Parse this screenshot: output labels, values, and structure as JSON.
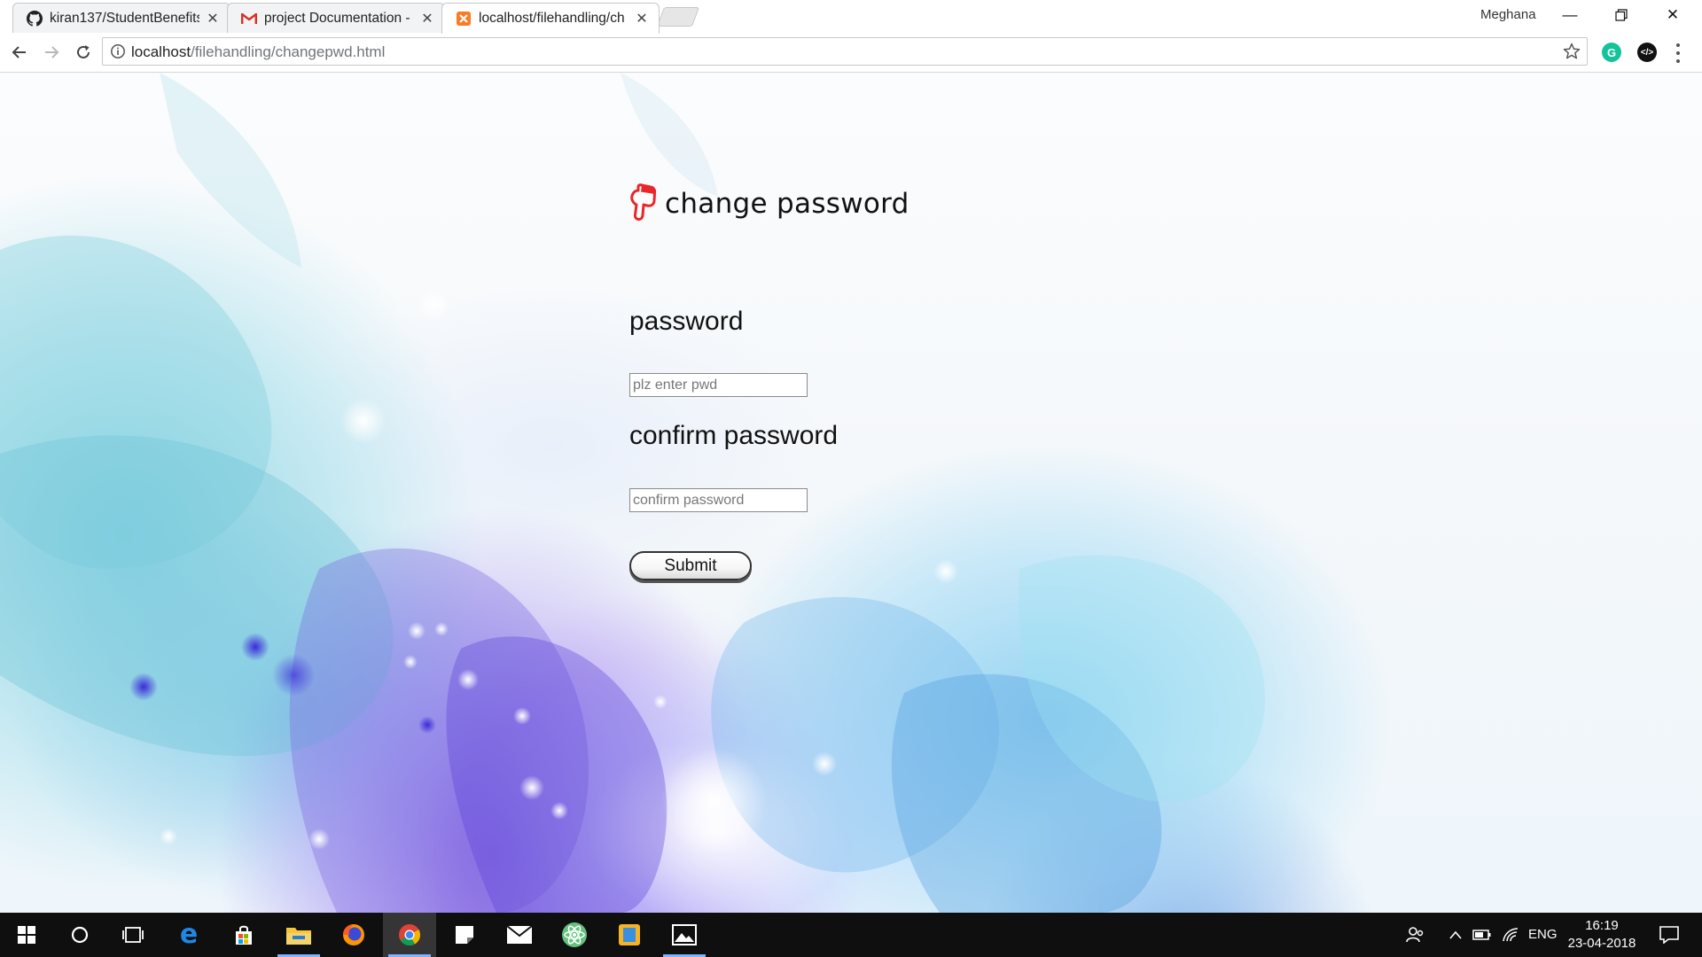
{
  "browser": {
    "tabs": [
      {
        "title": "kiran137/StudentBenefits",
        "favicon": "github-icon",
        "active": false
      },
      {
        "title": "project Documentation -",
        "favicon": "gmail-icon",
        "active": false
      },
      {
        "title": "localhost/filehandling/ch",
        "favicon": "xampp-icon",
        "active": true
      }
    ],
    "profile_name": "Meghana",
    "url_host": "localhost",
    "url_path": "/filehandling/changepwd.html"
  },
  "page": {
    "heading": "change password",
    "password_label": "password",
    "password_placeholder": "plz enter pwd",
    "confirm_label": "confirm password",
    "confirm_placeholder": "confirm password",
    "submit_label": "Submit"
  },
  "taskbar": {
    "apps": [
      "windows-start-icon",
      "cortana-icon",
      "task-view-icon",
      "edge-icon",
      "store-icon",
      "file-explorer-icon",
      "firefox-icon",
      "chrome-icon",
      "sticky-notes-icon",
      "mail-icon",
      "atom-icon",
      "app-icon",
      "photos-icon"
    ],
    "language": "ENG",
    "time": "16:19",
    "date": "23-04-2018"
  },
  "colors": {
    "hand_icon": "#e8262b",
    "taskbar": "#0f0f10",
    "grammarly": "#15c39a"
  }
}
